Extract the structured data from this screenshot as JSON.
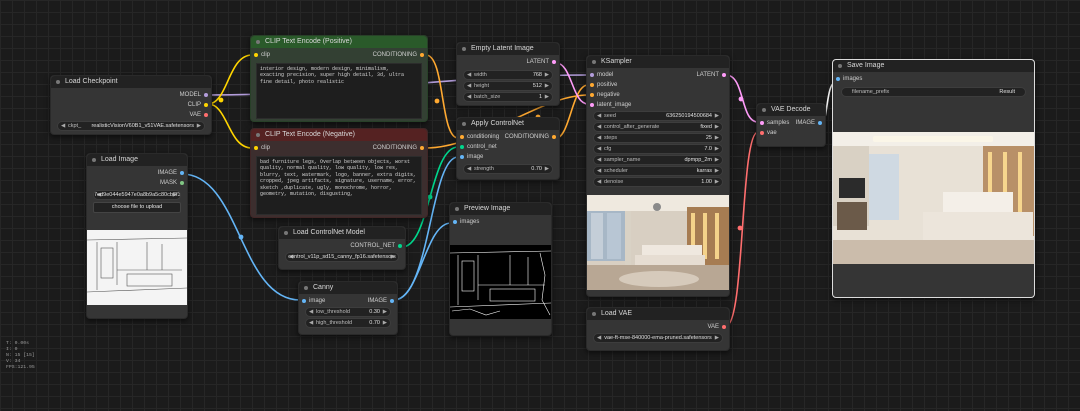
{
  "colors": {
    "model": "#b39ddb",
    "clip": "#ffd500",
    "vae": "#ff6e6e",
    "conditioning": "#ffa931",
    "latent": "#ff9cf9",
    "image": "#64b5f6",
    "mask": "#81c784",
    "control_net": "#00d78d"
  },
  "load_checkpoint": {
    "title": "Load Checkpoint",
    "out_model": "MODEL",
    "out_clip": "CLIP",
    "out_vae": "VAE",
    "ckpt_label": "ckpt_",
    "ckpt_value": "realisticVisionV60B1_v51VAE.safetensors"
  },
  "clip_pos": {
    "title": "CLIP Text Encode (Positive)",
    "in_clip": "clip",
    "out": "CONDITIONING",
    "text": "interior design, modern design, minimalism,  exacting precision, super high detail, 3d, ultra fine detail, photo realistic"
  },
  "clip_neg": {
    "title": "CLIP Text Encode (Negative)",
    "in_clip": "clip",
    "out": "CONDITIONING",
    "text": "bad furniture legs, Overlap between objects, worst quality, normal quality, low quality, low res, blurry, text, watermark, logo, banner, extra digits, cropped, jpeg artifacts, signature, username, error, sketch ,duplicate, ugly, monochrome, horror, geometry, mutation, disgusting,"
  },
  "empty_latent": {
    "title": "Empty Latent Image",
    "out": "LATENT",
    "width_label": "width",
    "width_value": "768",
    "height_label": "height",
    "height_value": "512",
    "batch_label": "batch_size",
    "batch_value": "1"
  },
  "apply_cn": {
    "title": "Apply ControlNet",
    "in_cond": "conditioning",
    "in_cn": "control_net",
    "in_image": "image",
    "out": "CONDITIONING",
    "strength_label": "strength",
    "strength_value": "0.70"
  },
  "ksampler": {
    "title": "KSampler",
    "in_model": "model",
    "in_pos": "positive",
    "in_neg": "negative",
    "in_latent": "latent_image",
    "out": "LATENT",
    "widgets": [
      {
        "label": "seed",
        "value": "636250194500684"
      },
      {
        "label": "control_after_generate",
        "value": "fixed"
      },
      {
        "label": "steps",
        "value": "25"
      },
      {
        "label": "cfg",
        "value": "7.0"
      },
      {
        "label": "sampler_name",
        "value": "dpmpp_2m"
      },
      {
        "label": "scheduler",
        "value": "karras"
      },
      {
        "label": "denoise",
        "value": "1.00"
      }
    ]
  },
  "vae_decode": {
    "title": "VAE Decode",
    "in_samples": "samples",
    "in_vae": "vae",
    "out": "IMAGE"
  },
  "save_image": {
    "title": "Save Image",
    "in_images": "images",
    "prefix_label": "filename_prefix",
    "prefix_value": "Result"
  },
  "load_image": {
    "title": "Load Image",
    "out_image": "IMAGE",
    "out_mask": "MASK",
    "file_value": "7ed9e044e5947e0a8b9a5c80cb3f3d.jpg",
    "upload_label": "choose file to upload"
  },
  "load_cn_model": {
    "title": "Load ControlNet Model",
    "out": "CONTROL_NET",
    "value": "control_v11p_sd15_canny_fp16.safetensors"
  },
  "canny": {
    "title": "Canny",
    "in_image": "image",
    "out": "IMAGE",
    "low_label": "low_threshold",
    "low_value": "0.30",
    "high_label": "high_threshold",
    "high_value": "0.70"
  },
  "preview": {
    "title": "Preview Image",
    "in_images": "images"
  },
  "load_vae": {
    "title": "Load VAE",
    "out": "VAE",
    "value": "vae-ft-mse-840000-ema-pruned.safetensors"
  },
  "stats": [
    "T: 0.00s",
    "I: 0",
    "N: 15 [15]",
    "V: 34",
    "FPS:121.95"
  ]
}
